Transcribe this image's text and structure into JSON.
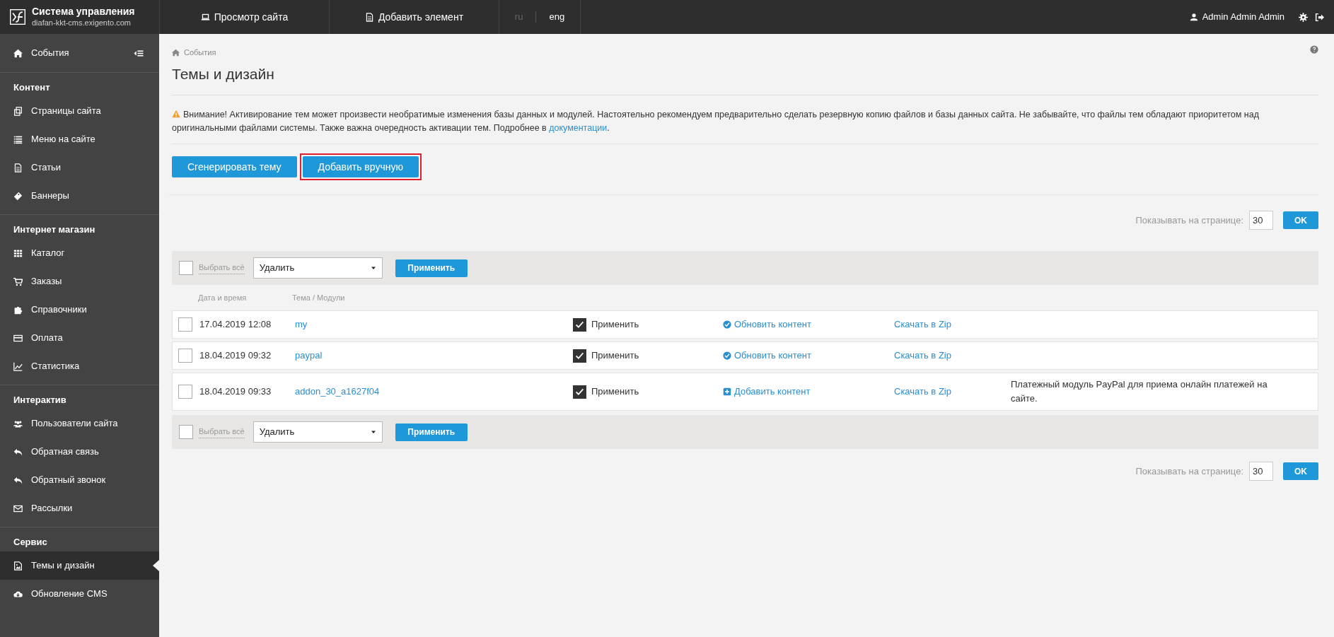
{
  "header": {
    "title": "Система управления",
    "subtitle": "diafan-kkt-cms.exigento.com",
    "nav": [
      {
        "label": "Просмотр сайта",
        "kind": "laptop"
      },
      {
        "label": "Добавить элемент",
        "kind": "file"
      }
    ],
    "languages": [
      {
        "label": "ru",
        "selected": false
      },
      {
        "label": "eng",
        "selected": true
      }
    ],
    "user": "Admin Admin Admin"
  },
  "sidebar": {
    "top": {
      "label": "События"
    },
    "sections": [
      {
        "title": "Контент",
        "items": [
          {
            "label": "Страницы сайта",
            "selected": false
          },
          {
            "label": "Меню на сайте",
            "selected": false
          },
          {
            "label": "Статьи",
            "selected": false
          },
          {
            "label": "Баннеры",
            "selected": false
          }
        ]
      },
      {
        "title": "Интернет магазин",
        "items": [
          {
            "label": "Каталог",
            "selected": false
          },
          {
            "label": "Заказы",
            "selected": false
          },
          {
            "label": "Справочники",
            "selected": false
          },
          {
            "label": "Оплата",
            "selected": false
          },
          {
            "label": "Статистика",
            "selected": false
          }
        ]
      },
      {
        "title": "Интерактив",
        "items": [
          {
            "label": "Пользователи сайта",
            "selected": false
          },
          {
            "label": "Обратная связь",
            "selected": false
          },
          {
            "label": "Обратный звонок",
            "selected": false
          },
          {
            "label": "Рассылки",
            "selected": false
          }
        ]
      },
      {
        "title": "Сервис",
        "items": [
          {
            "label": "Темы и дизайн",
            "selected": true
          },
          {
            "label": "Обновление CMS",
            "selected": false
          }
        ]
      }
    ]
  },
  "breadcrumb": "События",
  "page_title": "Темы и дизайн",
  "warning": {
    "text": "Внимание! Активирование тем может произвести необратимые изменения базы данных и модулей. Настоятельно рекомендуем предварительно сделать резервную копию файлов и базы данных сайта. Не забывайте, что файлы тем обладают приоритетом над оригинальными файлами системы. Также важна очередность активации тем. Подробнее в",
    "link": "документации",
    "end": "."
  },
  "buttons": [
    {
      "label": "Сгенерировать тему",
      "highlighted": false
    },
    {
      "label": "Добавить вручную",
      "highlighted": true
    }
  ],
  "per_page_top": {
    "label": "Показывать на странице:",
    "value": "30",
    "button": "OK"
  },
  "toolbar_top": {
    "select_all": "Выбрать всё",
    "checked": false,
    "action": "Удалить",
    "apply": "Применить"
  },
  "table": {
    "columns": [
      "Дата и время",
      "Тема / Модули"
    ],
    "rows": [
      {
        "checked": false,
        "date": "17.04.2019 12:08",
        "theme": "my",
        "apply_checked": true,
        "apply": "Применить",
        "kind": "update",
        "action": "Обновить контент",
        "zip": "Скачать в Zip"
      },
      {
        "checked": false,
        "date": "18.04.2019 09:32",
        "theme": "paypal",
        "apply_checked": true,
        "apply": "Применить",
        "kind": "update",
        "action": "Обновить контент",
        "zip": "Скачать в Zip"
      },
      {
        "checked": false,
        "date": "18.04.2019 09:33",
        "theme": "addon_30_a1627f04",
        "apply_checked": true,
        "apply": "Применить",
        "kind": "add",
        "action": "Добавить контент",
        "zip": "Скачать в Zip",
        "description": "Платежный модуль PayPal для приема онлайн платежей на сайте."
      }
    ]
  },
  "toolbar_bottom": {
    "select_all": "Выбрать всё",
    "checked": false,
    "action": "Удалить",
    "apply": "Применить"
  },
  "per_page_bottom": {
    "label": "Показывать на странице:",
    "value": "30",
    "button": "OK"
  }
}
